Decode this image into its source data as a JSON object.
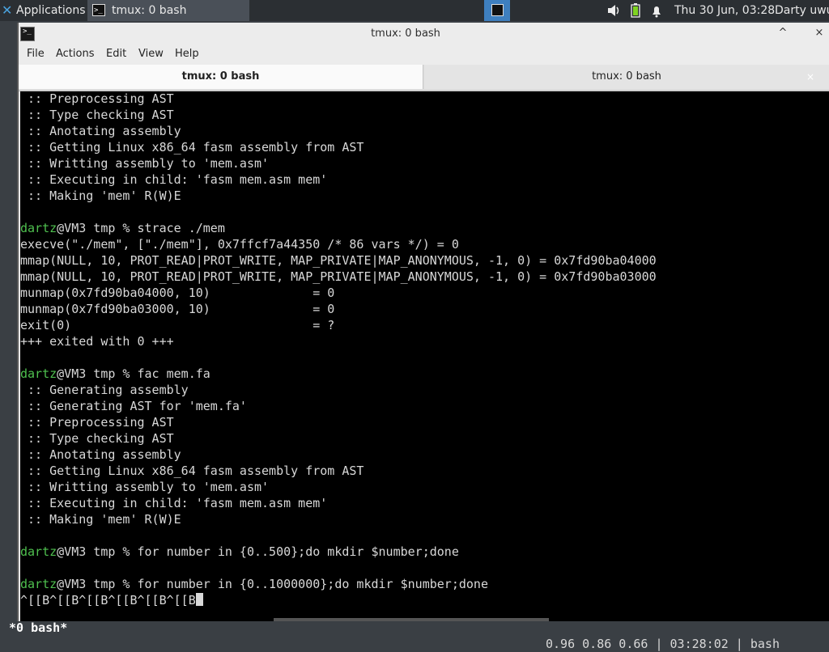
{
  "panel": {
    "apps_label": "Applications",
    "task_label": "tmux: 0 bash",
    "clock": "Thu 30 Jun, 03:28",
    "user": "Darty uwu",
    "icons": [
      "xfce-icon",
      "terminal-icon",
      "volume-icon",
      "battery-icon",
      "notification-bell-icon"
    ]
  },
  "window": {
    "title": "tmux: 0 bash",
    "menu": [
      "File",
      "Actions",
      "Edit",
      "View",
      "Help"
    ],
    "tabs": [
      {
        "label": "tmux: 0 bash",
        "active": true
      },
      {
        "label": "tmux: 0 bash",
        "active": false
      }
    ],
    "tab_close": "×",
    "btn_collapse": "^",
    "btn_close": "×"
  },
  "terminal": {
    "lines": [
      " :: Preprocessing AST",
      " :: Type checking AST",
      " :: Anotating assembly",
      " :: Getting Linux x86_64 fasm assembly from AST",
      " :: Writting assembly to 'mem.asm'",
      " :: Executing in child: 'fasm mem.asm mem'",
      " :: Making 'mem' R(W)E",
      "",
      "dartz@VM3 tmp % strace ./mem",
      "execve(\"./mem\", [\"./mem\"], 0x7ffcf7a44350 /* 86 vars */) = 0",
      "mmap(NULL, 10, PROT_READ|PROT_WRITE, MAP_PRIVATE|MAP_ANONYMOUS, -1, 0) = 0x7fd90ba04000",
      "mmap(NULL, 10, PROT_READ|PROT_WRITE, MAP_PRIVATE|MAP_ANONYMOUS, -1, 0) = 0x7fd90ba03000",
      "munmap(0x7fd90ba04000, 10)              = 0",
      "munmap(0x7fd90ba03000, 10)              = 0",
      "exit(0)                                 = ?",
      "+++ exited with 0 +++",
      "",
      "dartz@VM3 tmp % fac mem.fa",
      " :: Generating assembly",
      " :: Generating AST for 'mem.fa'",
      " :: Preprocessing AST",
      " :: Type checking AST",
      " :: Anotating assembly",
      " :: Getting Linux x86_64 fasm assembly from AST",
      " :: Writting assembly to 'mem.asm'",
      " :: Executing in child: 'fasm mem.asm mem'",
      " :: Making 'mem' R(W)E",
      "",
      "dartz@VM3 tmp % for number in {0..500};do mkdir $number;done",
      "",
      "dartz@VM3 tmp % for number in {0..1000000};do mkdir $number;done",
      "^[[B^[[B^[[B^[[B^[[B^[[B"
    ],
    "prompt_user": "dartz",
    "status_left": "*0 bash*",
    "status_right": "0.96 0.86 0.66 | 03:28:02 | bash",
    "user_color": "#4fc04f"
  }
}
